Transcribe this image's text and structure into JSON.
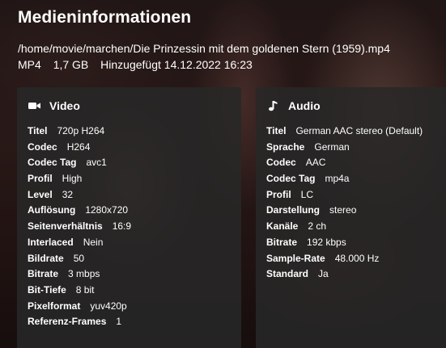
{
  "title": "Medieninformationen",
  "file": {
    "path": "/home/movie/marchen/Die Prinzessin mit dem goldenen Stern (1959).mp4",
    "container": "MP4",
    "size": "1,7 GB",
    "added": "Hinzugefügt 14.12.2022 16:23"
  },
  "video": {
    "heading": "Video",
    "icon": "video-camera-icon",
    "rows": [
      {
        "label": "Titel",
        "value": "720p H264"
      },
      {
        "label": "Codec",
        "value": "H264"
      },
      {
        "label": "Codec Tag",
        "value": "avc1"
      },
      {
        "label": "Profil",
        "value": "High"
      },
      {
        "label": "Level",
        "value": "32"
      },
      {
        "label": "Auflösung",
        "value": "1280x720"
      },
      {
        "label": "Seitenverhältnis",
        "value": "16:9"
      },
      {
        "label": "Interlaced",
        "value": "Nein"
      },
      {
        "label": "Bildrate",
        "value": "50"
      },
      {
        "label": "Bitrate",
        "value": "3 mbps"
      },
      {
        "label": "Bit-Tiefe",
        "value": "8 bit"
      },
      {
        "label": "Pixelformat",
        "value": "yuv420p"
      },
      {
        "label": "Referenz-Frames",
        "value": "1"
      }
    ]
  },
  "audio": {
    "heading": "Audio",
    "icon": "music-note-icon",
    "rows": [
      {
        "label": "Titel",
        "value": "German AAC stereo (Default)"
      },
      {
        "label": "Sprache",
        "value": "German"
      },
      {
        "label": "Codec",
        "value": "AAC"
      },
      {
        "label": "Codec Tag",
        "value": "mp4a"
      },
      {
        "label": "Profil",
        "value": "LC"
      },
      {
        "label": "Darstellung",
        "value": "stereo"
      },
      {
        "label": "Kanäle",
        "value": "2 ch"
      },
      {
        "label": "Bitrate",
        "value": "192 kbps"
      },
      {
        "label": "Sample-Rate",
        "value": "48.000 Hz"
      },
      {
        "label": "Standard",
        "value": "Ja"
      }
    ]
  }
}
